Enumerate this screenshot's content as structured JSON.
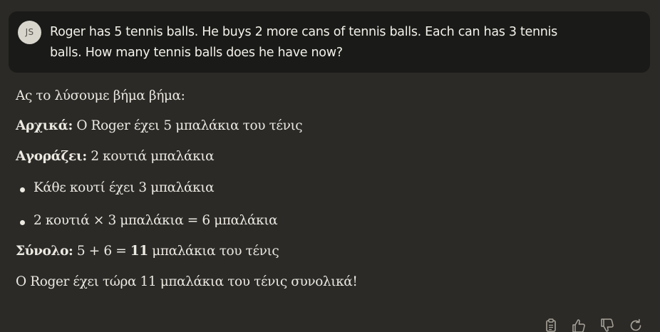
{
  "user": {
    "avatar_initials": "JS",
    "message_line1": "Roger has 5 tennis balls. He buys 2 more cans of tennis balls. Each can has 3 tennis",
    "message_line2": "balls. How many tennis balls does he have now?"
  },
  "response": {
    "intro": "Ας το λύσουμε βήμα βήμα:",
    "initial_label": "Αρχικά:",
    "initial_text": "Ο Roger έχει 5 μπαλάκια του τένις",
    "buys_label": "Αγοράζει:",
    "buys_text": "2 κουτιά μπαλάκια",
    "bullets": [
      "Κάθε κουτί έχει 3 μπαλάκια",
      "2 κουτιά × 3 μπαλάκια = 6 μπαλάκια"
    ],
    "total_label": "Σύνολο:",
    "total_expr": "5 + 6 =",
    "total_value": "11",
    "total_suffix": "μπαλάκια του τένις",
    "conclusion": "Ο Roger έχει τώρα 11 μπαλάκια του τένις συνολικά!"
  },
  "actions": {
    "icons": [
      "copy-icon",
      "thumbs-up-icon",
      "thumbs-down-icon",
      "retry-icon"
    ]
  }
}
